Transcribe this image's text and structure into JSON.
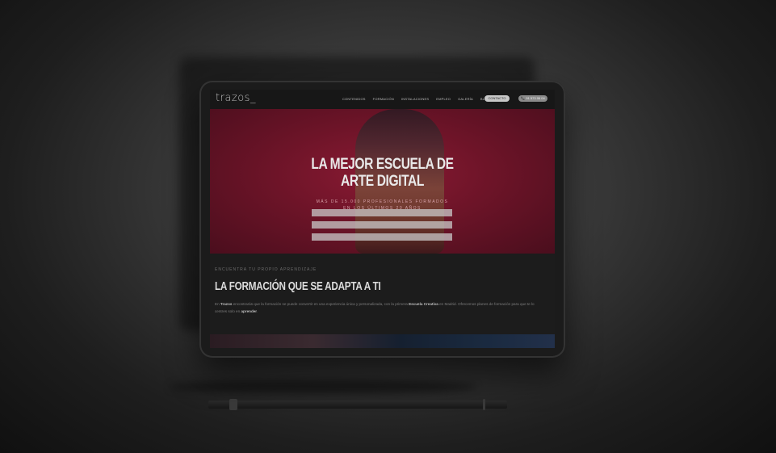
{
  "site": {
    "logo": "trazos_"
  },
  "nav": {
    "items": [
      "CONTENIDOS",
      "FORMACIÓN",
      "INSTALACIONES",
      "EMPLEO",
      "GALERÍA",
      "BLOG"
    ],
    "contact_button": "CONTACTO",
    "phone_button": "📞 91 573 06 04"
  },
  "hero": {
    "title_line1": "LA MEJOR ESCUELA DE",
    "title_line2": "ARTE DIGITAL",
    "subtitle_line1": "MÁS DE 15.000 PROFESIONALES FORMADOS",
    "subtitle_line2": "EN LOS ÚLTIMOS 20 AÑOS"
  },
  "section": {
    "kicker": "ENCUENTRA TU PROPIO APRENDIZAJE",
    "title": "LA FORMACIÓN QUE SE ADAPTA A TI",
    "para_a": "En ",
    "para_brand": "Trazos",
    "para_b": " encontrarás que la formación se puede convertir en una experiencia única y personalizada, con la primera ",
    "para_bold2": "Escuela Creativa",
    "para_c": " en Madrid. Ofrecemos planes de formación para que te lo ",
    "para_c2": "centres solo en ",
    "para_bold3": "aprender",
    "para_end": "."
  }
}
